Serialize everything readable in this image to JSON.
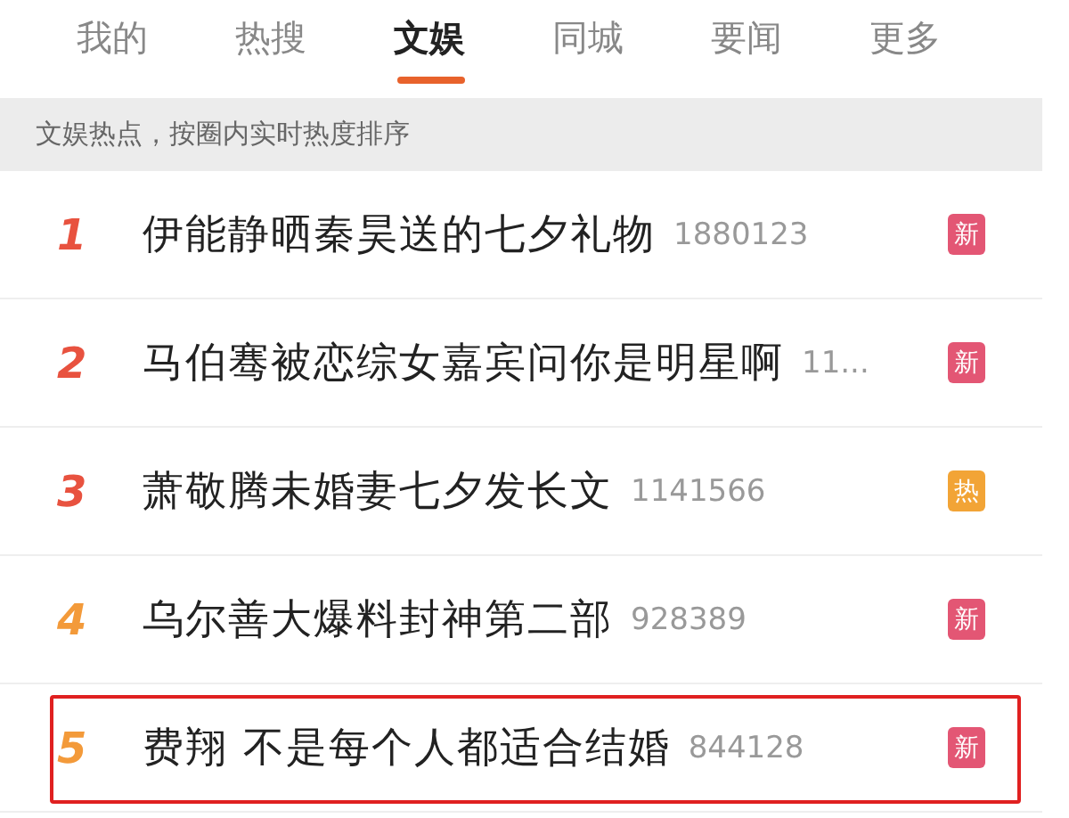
{
  "tabs": [
    {
      "label": "我的",
      "selected": false
    },
    {
      "label": "热搜",
      "selected": false
    },
    {
      "label": "文娱",
      "selected": true
    },
    {
      "label": "同城",
      "selected": false
    },
    {
      "label": "要闻",
      "selected": false
    },
    {
      "label": "更多",
      "selected": false
    }
  ],
  "banner": "文娱热点，按圈内实时热度排序",
  "rows": [
    {
      "rank": "1",
      "color": "#e8523f",
      "title": "伊能静晒秦昊送的七夕礼物",
      "count": "1880123",
      "badge": {
        "text": "新",
        "color": "#e35674"
      },
      "highlighted": false
    },
    {
      "rank": "2",
      "color": "#e8523f",
      "title": "马伯骞被恋综女嘉宾问你是明星啊",
      "count": "11...",
      "badge": {
        "text": "新",
        "color": "#e35674"
      },
      "highlighted": false
    },
    {
      "rank": "3",
      "color": "#e8523f",
      "title": "萧敬腾未婚妻七夕发长文",
      "count": "1141566",
      "badge": {
        "text": "热",
        "color": "#f2a436"
      },
      "highlighted": false
    },
    {
      "rank": "4",
      "color": "#f39a3a",
      "title": "乌尔善大爆料封神第二部",
      "count": "928389",
      "badge": {
        "text": "新",
        "color": "#e35674"
      },
      "highlighted": false
    },
    {
      "rank": "5",
      "color": "#f39a3a",
      "title": "费翔 不是每个人都适合结婚",
      "count": "844128",
      "badge": {
        "text": "新",
        "color": "#e35674"
      },
      "highlighted": true
    }
  ]
}
